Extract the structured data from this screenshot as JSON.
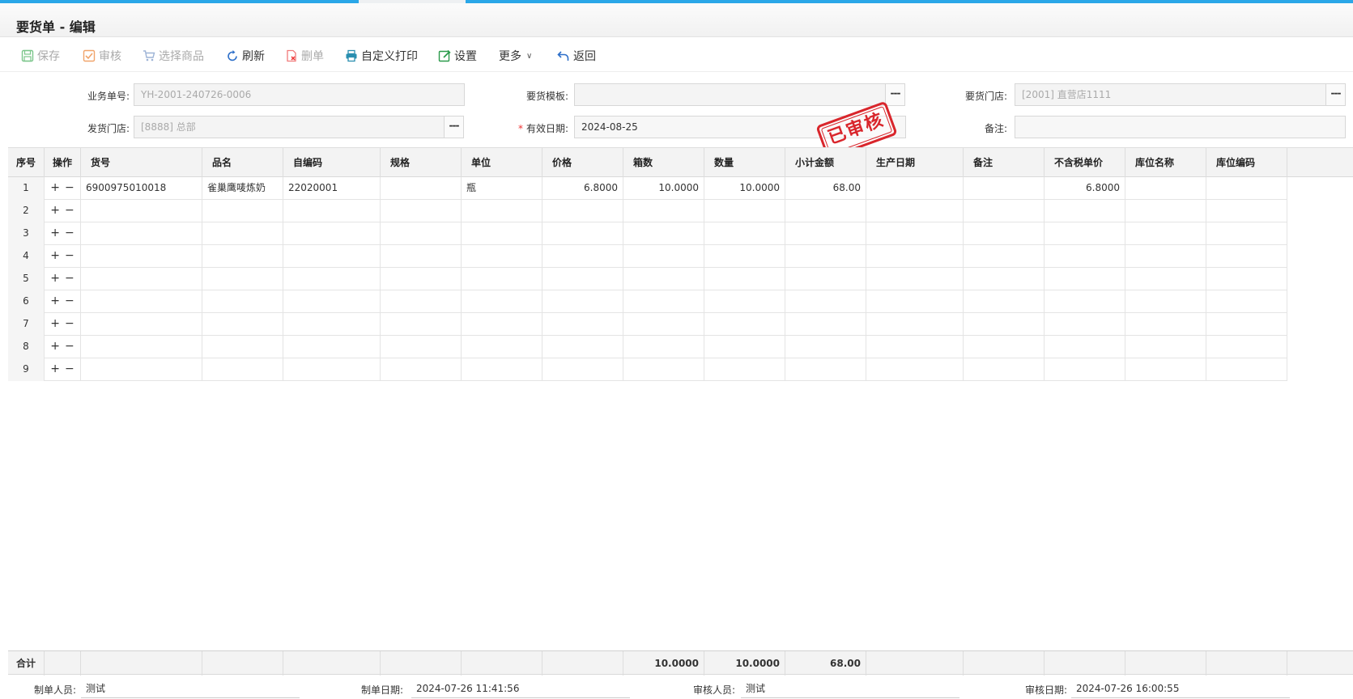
{
  "window": {
    "title": "要货单 - 编辑"
  },
  "toolbar": {
    "save": "保存",
    "audit": "审核",
    "select_goods": "选择商品",
    "refresh": "刷新",
    "delete": "删单",
    "custom_print": "自定义打印",
    "settings": "设置",
    "more": "更多",
    "back": "返回"
  },
  "form": {
    "order_no_label": "业务单号:",
    "order_no_value": "YH-2001-240726-0006",
    "template_label": "要货模板:",
    "template_value": "",
    "request_store_label": "要货门店:",
    "request_store_value": "[2001] 直营店1111",
    "ship_store_label": "发货门店:",
    "ship_store_value": "[8888] 总部",
    "valid_date_label": "有效日期:",
    "valid_date_value": "2024-08-25",
    "remark_label": "备注:",
    "remark_value": "",
    "dots": "---",
    "required_mark": "*"
  },
  "stamp": "已审核",
  "table": {
    "columns": {
      "seq": "序号",
      "ops": "操作",
      "code": "货号",
      "name": "品名",
      "self_code": "自编码",
      "spec": "规格",
      "unit": "单位",
      "price": "价格",
      "boxes": "箱数",
      "qty": "数量",
      "subtotal": "小计金额",
      "prod_date": "生产日期",
      "remark": "备注",
      "untaxed_price": "不含税单价",
      "loc_name": "库位名称",
      "loc_code": "库位编码"
    },
    "rows": [
      {
        "seq": "1",
        "code": "6900975010018",
        "name": "雀巢鹰唛炼奶",
        "self_code": "22020001",
        "spec": "",
        "unit": "瓶",
        "price": "6.8000",
        "boxes": "10.0000",
        "qty": "10.0000",
        "subtotal": "68.00",
        "prod_date": "",
        "remark": "",
        "untaxed_price": "6.8000",
        "loc_name": "",
        "loc_code": ""
      },
      {
        "seq": "2",
        "code": "",
        "name": "",
        "self_code": "",
        "spec": "",
        "unit": "",
        "price": "",
        "boxes": "",
        "qty": "",
        "subtotal": "",
        "prod_date": "",
        "remark": "",
        "untaxed_price": "",
        "loc_name": "",
        "loc_code": ""
      },
      {
        "seq": "3",
        "code": "",
        "name": "",
        "self_code": "",
        "spec": "",
        "unit": "",
        "price": "",
        "boxes": "",
        "qty": "",
        "subtotal": "",
        "prod_date": "",
        "remark": "",
        "untaxed_price": "",
        "loc_name": "",
        "loc_code": ""
      },
      {
        "seq": "4",
        "code": "",
        "name": "",
        "self_code": "",
        "spec": "",
        "unit": "",
        "price": "",
        "boxes": "",
        "qty": "",
        "subtotal": "",
        "prod_date": "",
        "remark": "",
        "untaxed_price": "",
        "loc_name": "",
        "loc_code": ""
      },
      {
        "seq": "5",
        "code": "",
        "name": "",
        "self_code": "",
        "spec": "",
        "unit": "",
        "price": "",
        "boxes": "",
        "qty": "",
        "subtotal": "",
        "prod_date": "",
        "remark": "",
        "untaxed_price": "",
        "loc_name": "",
        "loc_code": ""
      },
      {
        "seq": "6",
        "code": "",
        "name": "",
        "self_code": "",
        "spec": "",
        "unit": "",
        "price": "",
        "boxes": "",
        "qty": "",
        "subtotal": "",
        "prod_date": "",
        "remark": "",
        "untaxed_price": "",
        "loc_name": "",
        "loc_code": ""
      },
      {
        "seq": "7",
        "code": "",
        "name": "",
        "self_code": "",
        "spec": "",
        "unit": "",
        "price": "",
        "boxes": "",
        "qty": "",
        "subtotal": "",
        "prod_date": "",
        "remark": "",
        "untaxed_price": "",
        "loc_name": "",
        "loc_code": ""
      },
      {
        "seq": "8",
        "code": "",
        "name": "",
        "self_code": "",
        "spec": "",
        "unit": "",
        "price": "",
        "boxes": "",
        "qty": "",
        "subtotal": "",
        "prod_date": "",
        "remark": "",
        "untaxed_price": "",
        "loc_name": "",
        "loc_code": ""
      },
      {
        "seq": "9",
        "code": "",
        "name": "",
        "self_code": "",
        "spec": "",
        "unit": "",
        "price": "",
        "boxes": "",
        "qty": "",
        "subtotal": "",
        "prod_date": "",
        "remark": "",
        "untaxed_price": "",
        "loc_name": "",
        "loc_code": ""
      }
    ],
    "ops_plus": "+",
    "ops_minus": "−",
    "total": {
      "label": "合计",
      "boxes": "10.0000",
      "qty": "10.0000",
      "subtotal": "68.00"
    }
  },
  "footer": {
    "creator_label": "制单人员:",
    "creator_value": "测试",
    "create_date_label": "制单日期:",
    "create_date_value": "2024-07-26 11:41:56",
    "auditor_label": "审核人员:",
    "auditor_value": "测试",
    "audit_date_label": "审核日期:",
    "audit_date_value": "2024-07-26 16:00:55"
  }
}
